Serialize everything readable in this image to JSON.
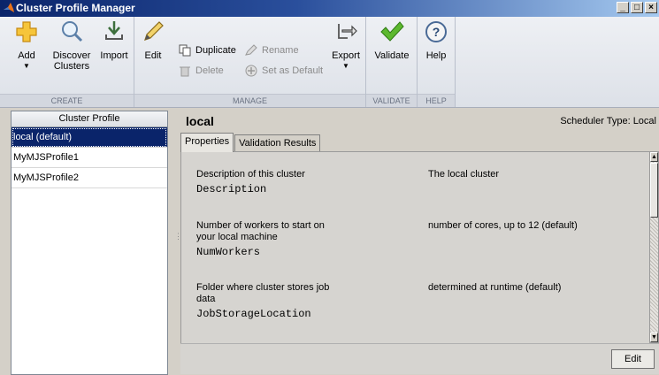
{
  "window": {
    "title": "Cluster Profile Manager",
    "controls": [
      "_",
      "□",
      "×"
    ]
  },
  "toolstrip": {
    "groups": {
      "create": "CREATE",
      "manage": "MANAGE",
      "validate": "VALIDATE",
      "help": "HELP"
    },
    "buttons": {
      "add": "Add",
      "discover_line1": "Discover",
      "discover_line2": "Clusters",
      "import": "Import",
      "edit": "Edit",
      "duplicate": "Duplicate",
      "delete": "Delete",
      "rename": "Rename",
      "set_default": "Set as Default",
      "export": "Export",
      "validate": "Validate",
      "help": "Help"
    },
    "icons": {
      "add": "plus-icon",
      "discover": "magnifier-icon",
      "import": "import-icon",
      "edit": "pencil-icon",
      "duplicate": "duplicate-icon",
      "delete": "trash-icon",
      "rename": "rename-icon",
      "set_default": "plus-circle-icon",
      "export": "export-icon",
      "validate": "checkmark-icon",
      "help": "question-icon"
    }
  },
  "profiles": {
    "header": "Cluster Profile",
    "items": [
      {
        "label": "local (default)",
        "selected": true
      },
      {
        "label": "MyMJSProfile1",
        "selected": false
      },
      {
        "label": "MyMJSProfile2",
        "selected": false
      }
    ]
  },
  "detail": {
    "title": "local",
    "scheduler_type": "Scheduler Type: Local",
    "tabs": [
      "Properties",
      "Validation Results"
    ],
    "active_tab": "Properties",
    "properties": [
      {
        "label_lines": [
          "Description of this cluster"
        ],
        "name": "Description",
        "value": "The local cluster"
      },
      {
        "label_lines": [
          "Number of workers to start on",
          "your local machine"
        ],
        "name": "NumWorkers",
        "value": "number of cores, up to 12 (default)"
      },
      {
        "label_lines": [
          "Folder where cluster stores job",
          "data"
        ],
        "name": "JobStorageLocation",
        "value": "determined at runtime (default)"
      }
    ],
    "edit_button": "Edit"
  },
  "colors": {
    "selection": "#0a246a",
    "titlebar_start": "#0a246a",
    "titlebar_end": "#a6caf0",
    "validate_check": "#5cb82e"
  }
}
